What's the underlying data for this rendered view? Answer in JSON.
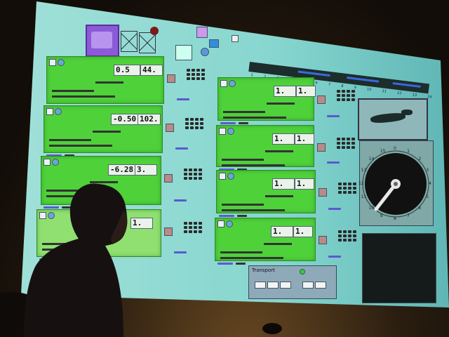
{
  "scene": {
    "screen_color": "#7fd4cf",
    "panel_color": "#4fd13a",
    "room_color": "#1a140e"
  },
  "channels": [
    {
      "value_a": "0.5",
      "value_b": "44."
    },
    {
      "value_a": "-0.50",
      "value_b": "102."
    },
    {
      "value_a": "-6.28",
      "value_b": "3."
    },
    {
      "value_a": "",
      "value_b": "1."
    },
    {
      "value_a": "1.",
      "value_b": "1."
    },
    {
      "value_a": "1.",
      "value_b": "1."
    },
    {
      "value_a": "1.",
      "value_b": "1."
    },
    {
      "value_a": "1.",
      "value_b": "1."
    }
  ],
  "dial": {
    "ticks": [
      "0",
      "1",
      "2",
      "3",
      "4",
      "5",
      "6",
      "7",
      "8",
      "9",
      "10",
      "11",
      "12",
      "13",
      "14",
      "15"
    ]
  },
  "timeline": {
    "ticks": [
      "1",
      "2",
      "3",
      "4",
      "5",
      "6",
      "7",
      "8",
      "9",
      "10",
      "11",
      "12",
      "13",
      "14"
    ]
  },
  "transport": {
    "title": "Transport"
  },
  "icons": [
    "patch-logo-icon",
    "record-dot-icon",
    "crossed-box-icon"
  ]
}
